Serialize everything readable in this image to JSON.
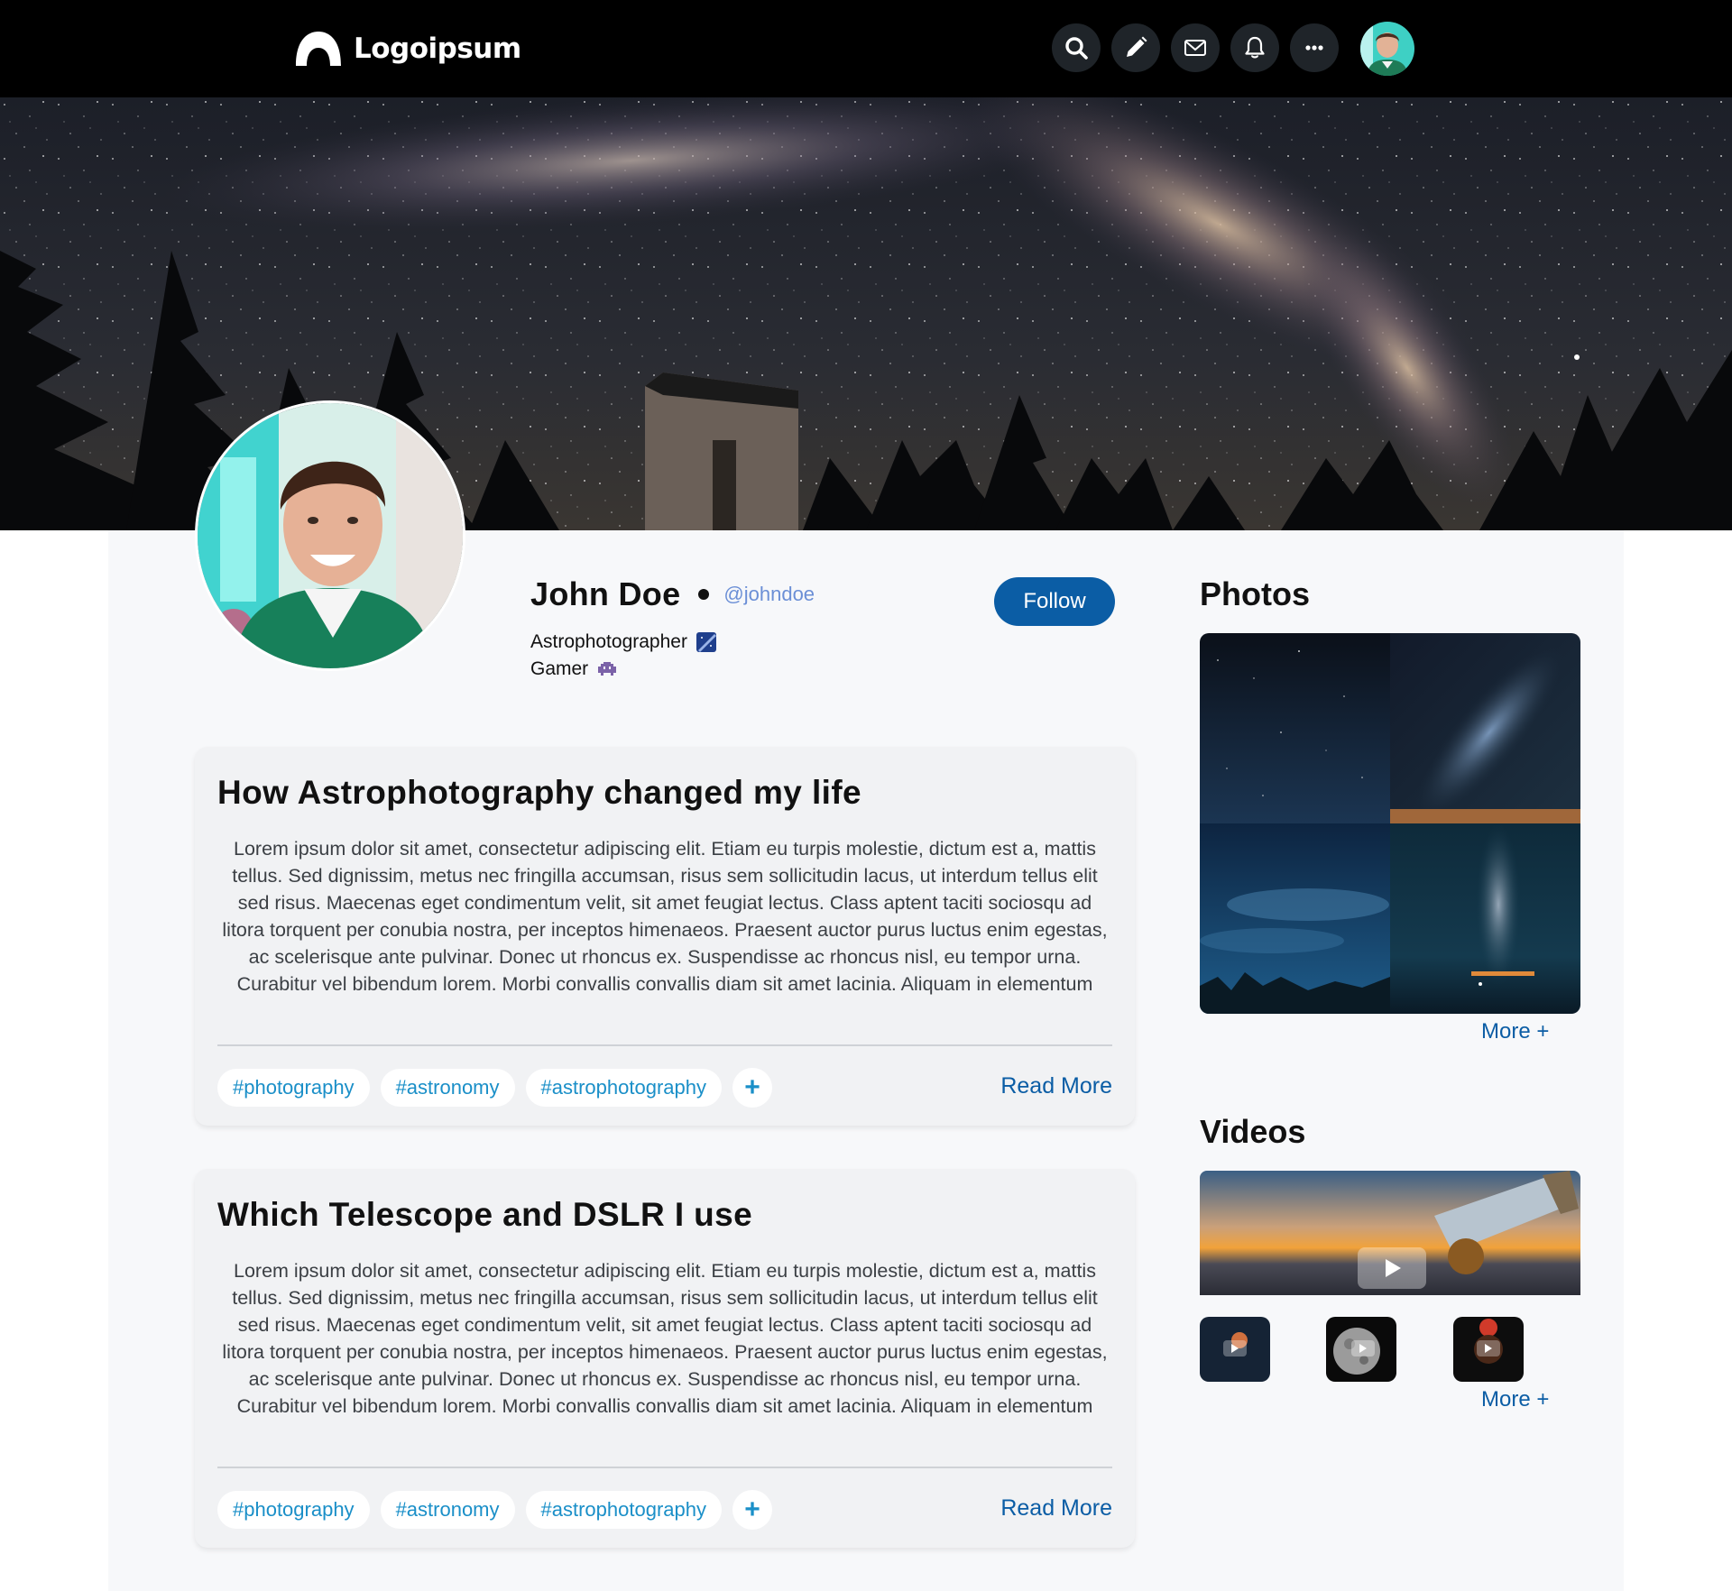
{
  "brand": {
    "name": "Logoipsum"
  },
  "nav": {
    "icons": [
      "search-icon",
      "pencil-icon",
      "mail-icon",
      "bell-icon",
      "more-icon"
    ]
  },
  "profile": {
    "name": "John Doe",
    "handle": "@johndoe",
    "bio_line_1": "Astrophotographer",
    "bio_line_2": "Gamer",
    "follow_label": "Follow"
  },
  "posts": [
    {
      "title": "How Astrophotography changed my life",
      "body": "Lorem ipsum dolor sit amet, consectetur adipiscing elit. Etiam eu turpis molestie, dictum est a, mattis tellus. Sed dignissim, metus nec fringilla accumsan, risus sem sollicitudin lacus, ut interdum tellus elit sed risus. Maecenas eget condimentum velit, sit amet feugiat lectus. Class aptent taciti sociosqu ad litora torquent per conubia nostra, per inceptos himenaeos. Praesent auctor purus luctus enim egestas, ac scelerisque ante pulvinar. Donec ut rhoncus ex. Suspendisse ac rhoncus nisl, eu tempor urna. Curabitur vel bibendum lorem. Morbi convallis convallis diam sit amet lacinia. Aliquam in elementum tellus.Curabitur tempor quis eros tempus lacinia. Nam",
      "tags": [
        "#photography",
        "#astronomy",
        "#astrophotography"
      ],
      "add_tag": "+",
      "read_more": "Read More"
    },
    {
      "title": "Which Telescope and DSLR I use",
      "body": "Lorem ipsum dolor sit amet, consectetur adipiscing elit. Etiam eu turpis molestie, dictum est a, mattis tellus. Sed dignissim, metus nec fringilla accumsan, risus sem sollicitudin lacus, ut interdum tellus elit sed risus. Maecenas eget condimentum velit, sit amet feugiat lectus. Class aptent taciti sociosqu ad litora torquent per conubia nostra, per inceptos himenaeos. Praesent auctor purus luctus enim egestas, ac scelerisque ante pulvinar. Donec ut rhoncus ex. Suspendisse ac rhoncus nisl, eu tempor urna. Curabitur vel bibendum lorem. Morbi convallis convallis diam sit amet lacinia. Aliquam in elementum tellus.Curabitur tempor quis eros tempus lacinia. Nam",
      "tags": [
        "#photography",
        "#astronomy",
        "#astrophotography"
      ],
      "add_tag": "+",
      "read_more": "Read More"
    }
  ],
  "sidebar": {
    "photos_heading": "Photos",
    "photos_more": "More +",
    "videos_heading": "Videos",
    "videos_more": "More +"
  },
  "colors": {
    "accent": "#0b5da5",
    "tag_text": "#1a8fc8",
    "topbar": "#000000",
    "panel": "#f7f8fa"
  }
}
